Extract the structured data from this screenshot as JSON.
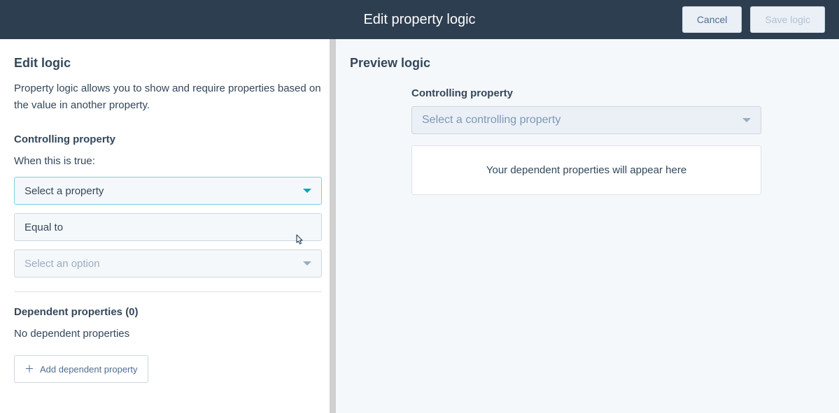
{
  "header": {
    "title": "Edit property logic",
    "cancel_label": "Cancel",
    "save_label": "Save logic"
  },
  "left": {
    "title": "Edit logic",
    "description": "Property logic allows you to show and require properties based on the value in another property.",
    "controlling_label": "Controlling property",
    "when_true_label": "When this is true:",
    "select_property_placeholder": "Select a property",
    "equal_to_label": "Equal to",
    "select_option_placeholder": "Select an option",
    "dependent_label": "Dependent properties (0)",
    "no_dependent_text": "No dependent properties",
    "add_dependent_label": "Add dependent property"
  },
  "right": {
    "title": "Preview logic",
    "controlling_label": "Controlling property",
    "select_placeholder": "Select a controlling property",
    "card_text": "Your dependent properties will appear here"
  }
}
